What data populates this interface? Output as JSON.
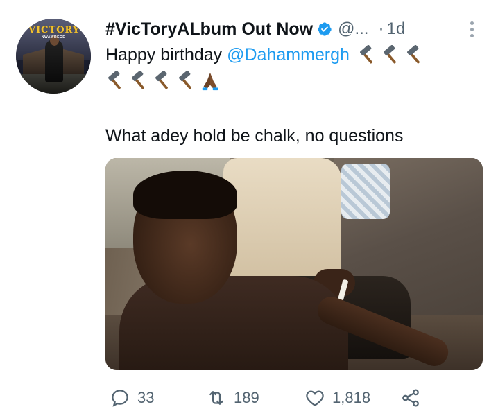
{
  "tweet": {
    "author": {
      "display_name": "#VicToryALbum Out Now",
      "handle": "@...",
      "verified": true,
      "avatar_text": "VICTORY",
      "avatar_subtext": "NWAWREGE"
    },
    "time_separator": "·",
    "timestamp": "1d",
    "text": {
      "greeting": "Happy birthday ",
      "mention": "@Dahammergh",
      "emojis_line1": [
        "hammer-icon",
        "hammer-icon",
        "hammer-icon"
      ],
      "emojis_line2": [
        "hammer-icon",
        "hammer-icon",
        "hammer-icon",
        "hammer-icon",
        "praying-hands-icon"
      ],
      "caption": "What adey hold be chalk, no questions"
    },
    "actions": {
      "replies": "33",
      "retweets": "189",
      "likes": "1,818"
    }
  },
  "colors": {
    "text_primary": "#0f1419",
    "text_secondary": "#536471",
    "accent": "#1d9bf0"
  }
}
